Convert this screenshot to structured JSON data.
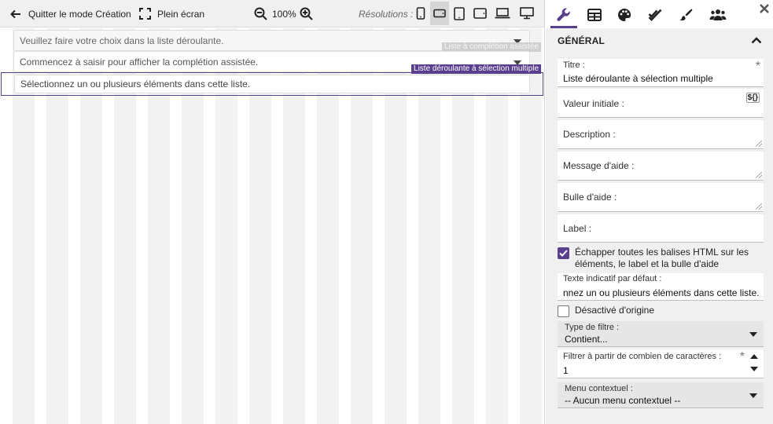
{
  "toolbar": {
    "exit_design_label": "Quitter le mode Création",
    "fullscreen_label": "Plein écran",
    "zoom_value": "100%",
    "resolutions_label": "Résolutions :"
  },
  "canvas": {
    "fields": [
      {
        "placeholder": "Veuillez faire votre choix dans la liste déroulante.",
        "tag": "Liste à complétion assistée"
      },
      {
        "placeholder": "Commencez à saisir pour afficher la complétion assistée.",
        "tag": "Liste déroulante à sélection multiple"
      },
      {
        "placeholder": "Sélectionnez un ou plusieurs éléments dans cette liste."
      }
    ]
  },
  "panel": {
    "tabs": [
      "wrench-icon",
      "table-icon",
      "palette-icon",
      "double-check-icon",
      "brush-icon",
      "users-icon"
    ],
    "section_title": "GÉNÉRAL",
    "titre_label": "Titre :",
    "titre_value": "Liste déroulante à sélection multiple",
    "valeur_initiale_label": "Valeur initiale :",
    "variable_badge": "${}",
    "description_label": "Description :",
    "message_aide_label": "Message d'aide :",
    "bulle_aide_label": "Bulle d'aide :",
    "label_label": "Label :",
    "escape_html_label": "Échapper toutes les balises HTML sur les éléments, le label et la bulle d'aide",
    "escape_html_checked": true,
    "texte_indicatif_label": "Texte indicatif par défaut :",
    "texte_indicatif_value": "nnez un ou plusieurs éléments dans cette liste.",
    "desactive_label": "Désactivé d'origine",
    "desactive_checked": false,
    "type_filtre_label": "Type de filtre :",
    "type_filtre_value": "Contient...",
    "filtrer_label": "Filtrer à partir de combien de caractères :",
    "filtrer_value": "1",
    "menu_contextuel_label": "Menu contextuel :",
    "menu_contextuel_value": "-- Aucun menu contextuel --"
  },
  "colors": {
    "accent": "#5b3f8f",
    "toolbar_bg": "#f0f0f0"
  }
}
